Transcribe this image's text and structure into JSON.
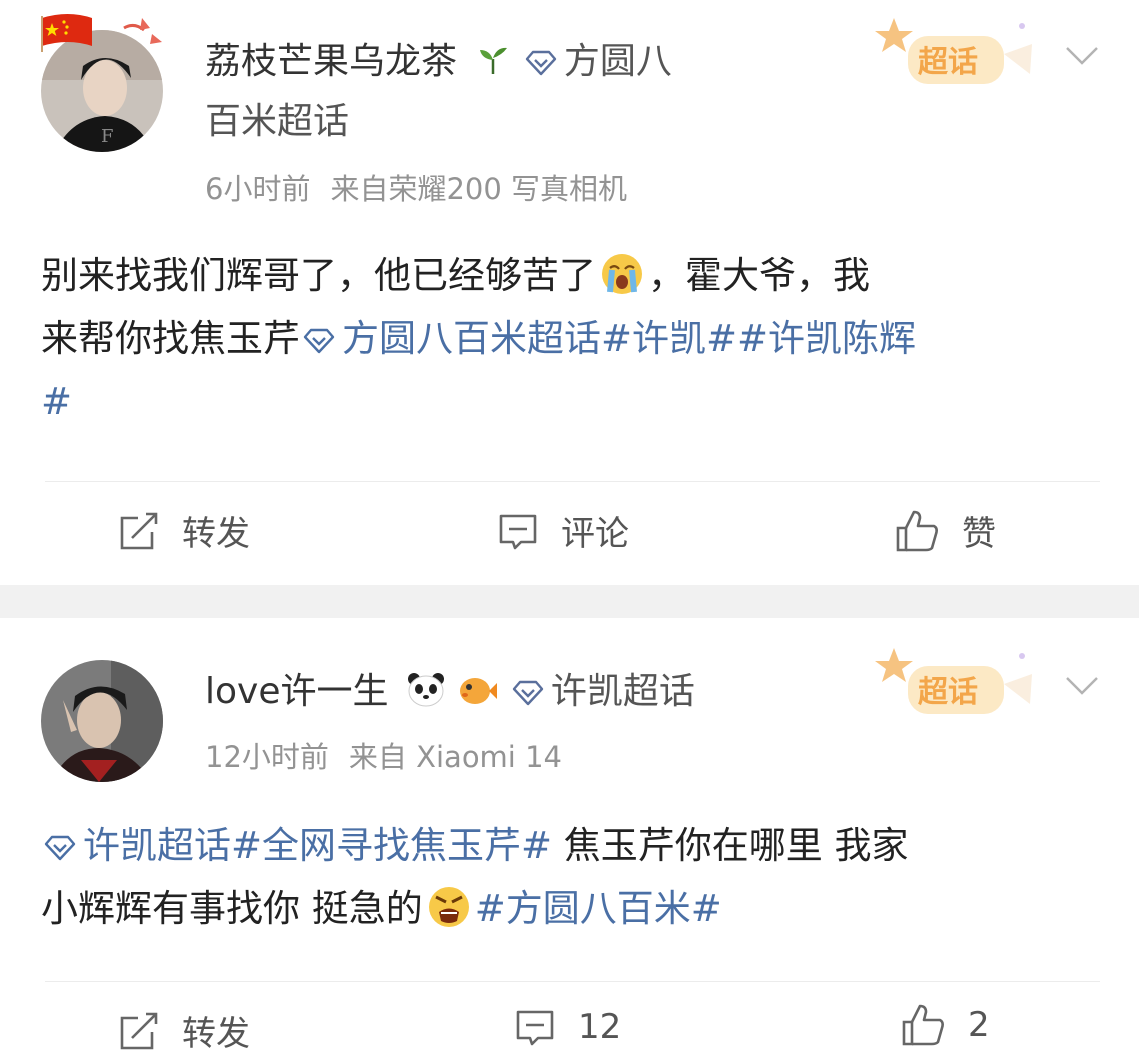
{
  "posts": [
    {
      "username": "荔枝芒果乌龙茶",
      "badge_label": "方圆八",
      "badge_label_line2": "百米超话",
      "time": "6小时前",
      "source": "来自荣耀200 写真相机",
      "content": {
        "line1_a": "别来找我们辉哥了，他已经够苦了",
        "line1_b": "，霍大爷，我",
        "line2_a": "来帮你找焦玉芹",
        "line2_topic": "方圆八百米超话#许凯##许凯陈辉",
        "line3": "#"
      },
      "actions": {
        "repost": "转发",
        "comment": "评论",
        "like": "赞"
      },
      "stamp_label": "超话"
    },
    {
      "username": "love许一生",
      "badge_label": "许凯超话",
      "time": "12小时前",
      "source": "来自 Xiaomi 14",
      "content": {
        "line1_topic": "许凯超话#全网寻找焦玉芹#",
        "line1_text": " 焦玉芹你在哪里 我家",
        "line2_a": "小辉辉有事找你 挺急的",
        "line2_topic": "#方圆八百米#"
      },
      "actions": {
        "repost": "转发",
        "comment": "12",
        "like": "2"
      },
      "stamp_label": "超话"
    }
  ],
  "colors": {
    "topic": "#4a6fa5",
    "meta": "#939393",
    "separator": "#f1f1f1"
  },
  "icons": [
    "china-flag-icon",
    "sprout-icon",
    "diamond-icon",
    "stamp-chaohua-icon",
    "chevron-down-icon",
    "repost-icon",
    "comment-icon",
    "like-icon",
    "panda-emoji",
    "pufferfish-emoji",
    "crying-emoji",
    "angry-emoji"
  ]
}
